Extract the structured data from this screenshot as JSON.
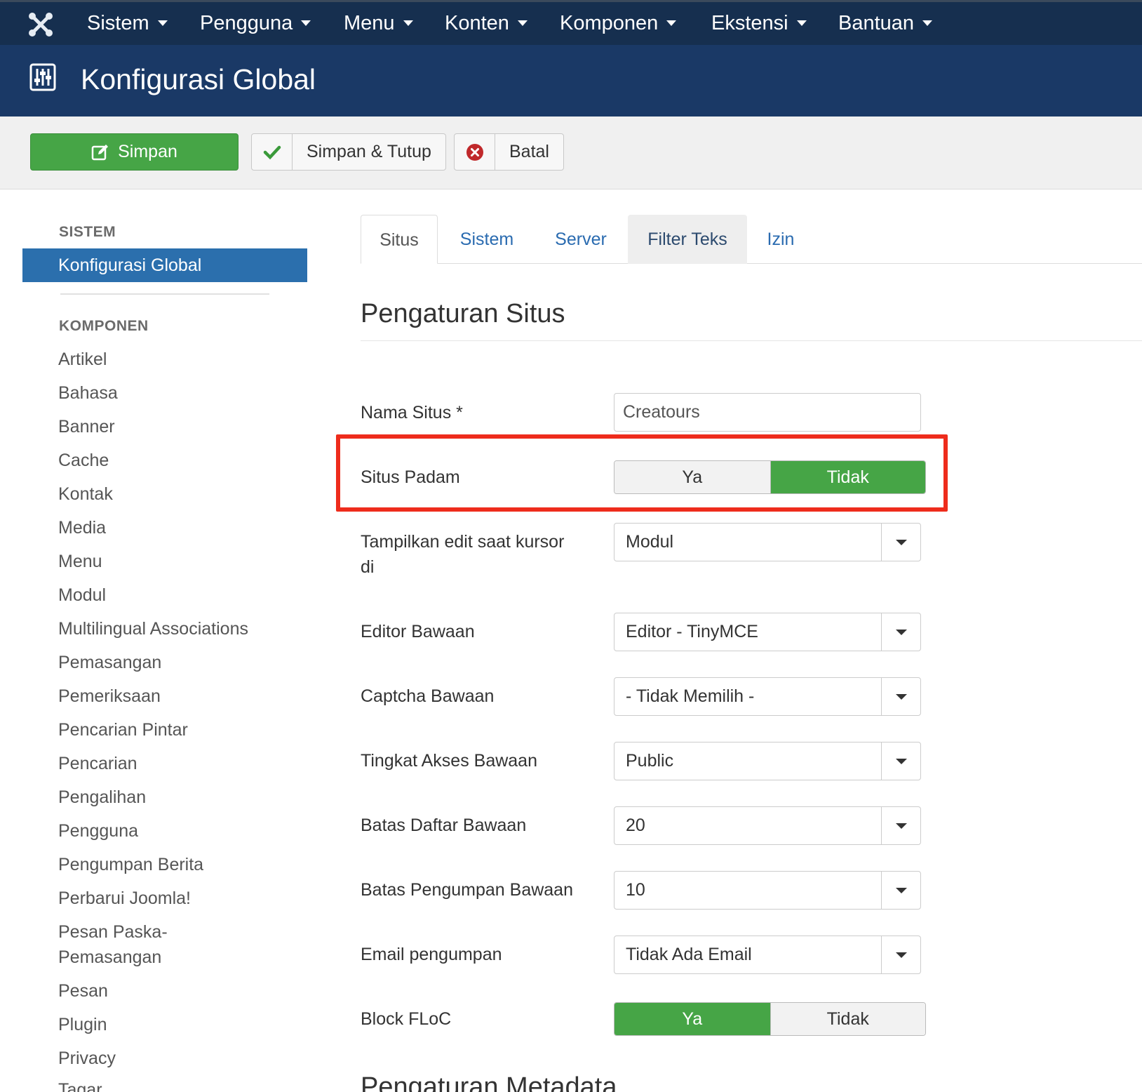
{
  "nav": {
    "items": [
      "Sistem",
      "Pengguna",
      "Menu",
      "Konten",
      "Komponen",
      "Ekstensi",
      "Bantuan"
    ]
  },
  "header": {
    "title": "Konfigurasi Global"
  },
  "toolbar": {
    "save": "Simpan",
    "save_close": "Simpan & Tutup",
    "cancel": "Batal"
  },
  "sidebar": {
    "system_heading": "SISTEM",
    "active_item": "Konfigurasi Global",
    "components_heading": "KOMPONEN",
    "items": [
      "Artikel",
      "Bahasa",
      "Banner",
      "Cache",
      "Kontak",
      "Media",
      "Menu",
      "Modul",
      "Multilingual Associations",
      "Pemasangan",
      "Pemeriksaan",
      "Pencarian Pintar",
      "Pencarian",
      "Pengalihan",
      "Pengguna",
      "Pengumpan Berita",
      "Perbarui Joomla!",
      "Pesan Paska-",
      "Pemasangan",
      "Pesan",
      "Plugin",
      "Privacy",
      "Tagar"
    ]
  },
  "tabs": [
    "Situs",
    "Sistem",
    "Server",
    "Filter Teks",
    "Izin"
  ],
  "section": {
    "title": "Pengaturan Situs",
    "next_title": "Pengaturan Metadata"
  },
  "fields": {
    "site_name": {
      "label": "Nama Situs *",
      "value": "Creatours"
    },
    "offline": {
      "label": "Situs Padam",
      "yes": "Ya",
      "no": "Tidak",
      "selected": "Tidak"
    },
    "frontend_edit": {
      "label_1": "Tampilkan edit saat kursor",
      "label_2": "di",
      "value": "Modul"
    },
    "editor": {
      "label": "Editor Bawaan",
      "value": "Editor - TinyMCE"
    },
    "captcha": {
      "label": "Captcha Bawaan",
      "value": "- Tidak Memilih -"
    },
    "access": {
      "label": "Tingkat Akses Bawaan",
      "value": "Public"
    },
    "list_limit": {
      "label": "Batas Daftar Bawaan",
      "value": "20"
    },
    "feed_limit": {
      "label": "Batas Pengumpan Bawaan",
      "value": "10"
    },
    "feed_email": {
      "label": "Email pengumpan",
      "value": "Tidak Ada Email"
    },
    "floc": {
      "label": "Block FLoC",
      "yes": "Ya",
      "no": "Tidak",
      "selected": "Ya"
    }
  },
  "colors": {
    "nav_bg": "#162f4f",
    "title_bg": "#1a3966",
    "success": "#46a546",
    "accent": "#2b6fad",
    "highlight": "#ee2c1c"
  }
}
